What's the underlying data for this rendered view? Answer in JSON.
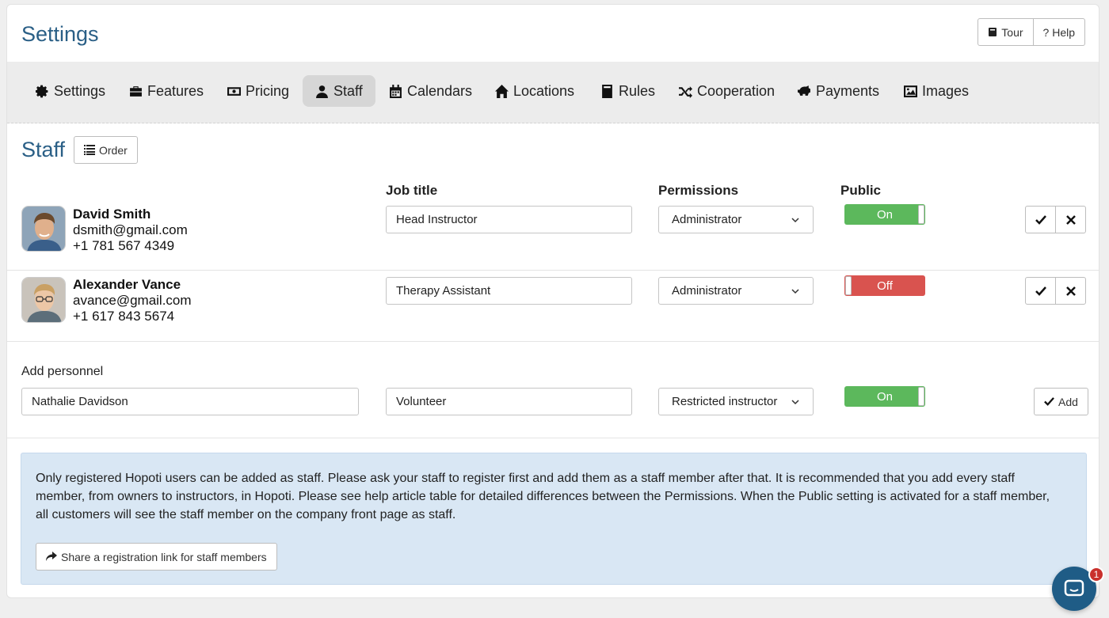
{
  "header": {
    "title": "Settings",
    "tour_label": "Tour",
    "help_label": "? Help"
  },
  "tabs": [
    {
      "label": "Settings",
      "icon": "gear-icon"
    },
    {
      "label": "Features",
      "icon": "briefcase-icon"
    },
    {
      "label": "Pricing",
      "icon": "money-icon"
    },
    {
      "label": "Staff",
      "icon": "user-icon",
      "active": true
    },
    {
      "label": "Calendars",
      "icon": "calendar-icon"
    },
    {
      "label": "Locations",
      "icon": "home-icon"
    },
    {
      "label": "Rules",
      "icon": "book-icon"
    },
    {
      "label": "Cooperation",
      "icon": "shuffle-icon"
    },
    {
      "label": "Payments",
      "icon": "piggy-bank-icon"
    },
    {
      "label": "Images",
      "icon": "image-icon"
    }
  ],
  "staff": {
    "title": "Staff",
    "order_label": "Order",
    "columns": {
      "job_title": "Job title",
      "permissions": "Permissions",
      "public": "Public"
    },
    "members": [
      {
        "name": "David Smith",
        "email": "dsmith@gmail.com",
        "phone": "+1 781 567 4349",
        "job_title": "Head Instructor",
        "permission": "Administrator",
        "public": "On"
      },
      {
        "name": "Alexander Vance",
        "email": "avance@gmail.com",
        "phone": "+1 617 843 5674",
        "job_title": "Therapy Assistant",
        "permission": "Administrator",
        "public": "Off"
      }
    ],
    "add": {
      "label": "Add personnel",
      "name_value": "Nathalie Davidson",
      "job_title_value": "Volunteer",
      "permission": "Restricted instructor",
      "public": "On",
      "button_label": "Add"
    }
  },
  "info": {
    "text": "Only registered Hopoti users can be added as staff. Please ask your staff to register first and add them as a staff member after that. It is recommended that you add every staff member, from owners to instructors, in Hopoti. Please see help article table for detailed differences between the Permissions. When the Public setting is activated for a staff member, all customers will see the staff member on the company front page as staff.",
    "share_label": "Share a registration link for staff members"
  },
  "chat": {
    "badge_count": "1"
  },
  "colors": {
    "accent": "#2a5f86",
    "toggle_on": "#5cb85c",
    "toggle_off": "#d9534f",
    "info_bg": "#d9e7f4"
  }
}
